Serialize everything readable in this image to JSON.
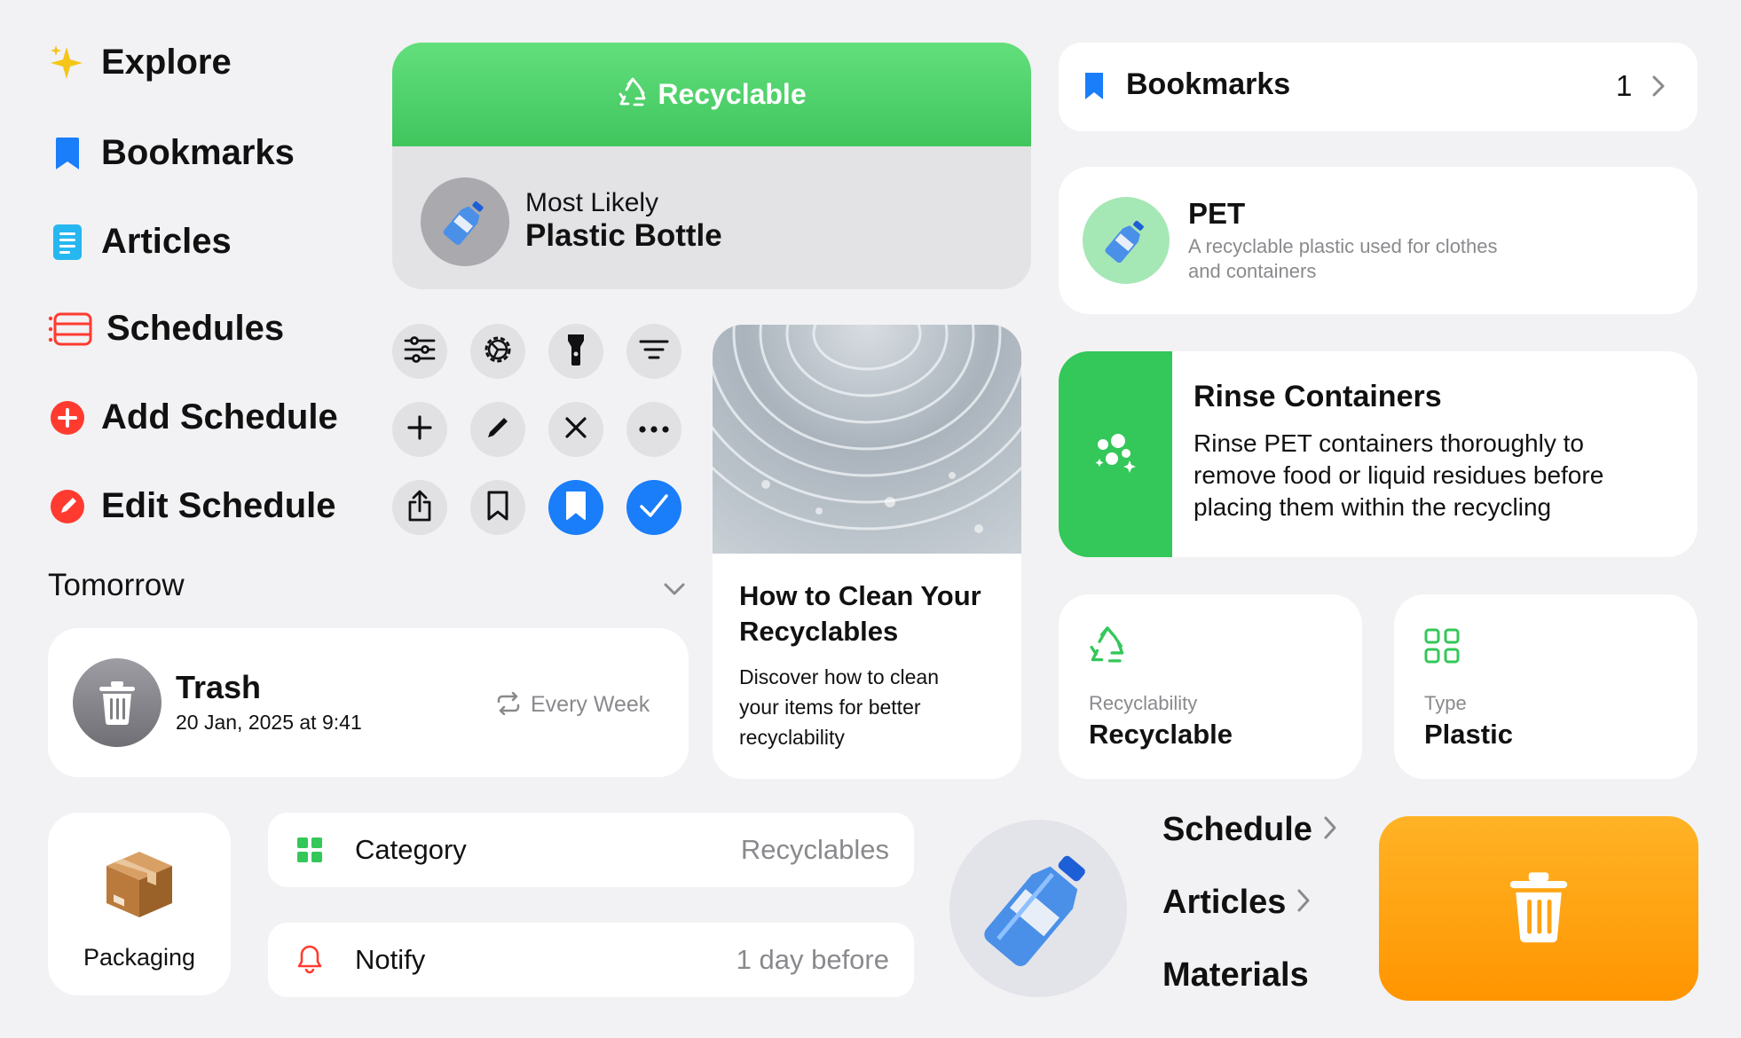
{
  "sidebar": {
    "items": [
      {
        "label": "Explore"
      },
      {
        "label": "Bookmarks"
      },
      {
        "label": "Articles"
      },
      {
        "label": "Schedules"
      },
      {
        "label": "Add Schedule"
      },
      {
        "label": "Edit Schedule"
      }
    ]
  },
  "scan_card": {
    "header": "Recyclable",
    "subtitle": "Most Likely",
    "title": "Plastic Bottle"
  },
  "schedule_section": {
    "header": "Tomorrow",
    "item_title": "Trash",
    "item_date": "20 Jan, 2025 at 9:41",
    "repeat": "Every Week"
  },
  "article_card": {
    "title": "How to Clean Your Recyclables",
    "body": "Discover how to clean your items for better recyclability"
  },
  "bookmarks_row": {
    "label": "Bookmarks",
    "count": "1"
  },
  "pet_card": {
    "title": "PET",
    "description": "A recyclable plastic used for clothes and containers"
  },
  "rinse_card": {
    "title": "Rinse Containers",
    "body": "Rinse PET containers thoroughly to remove food or liquid residues before placing them within the recycling"
  },
  "info_tiles": [
    {
      "label": "Recyclability",
      "value": "Recyclable"
    },
    {
      "label": "Type",
      "value": "Plastic"
    }
  ],
  "packaging_tile": {
    "label": "Packaging"
  },
  "settings_rows": [
    {
      "label": "Category",
      "value": "Recyclables"
    },
    {
      "label": "Notify",
      "value": "1 day before"
    }
  ],
  "nav_links": [
    {
      "label": "Schedule"
    },
    {
      "label": "Articles"
    },
    {
      "label": "Materials"
    }
  ],
  "colors": {
    "accent_green": "#34c759",
    "accent_blue": "#1a7dfa",
    "accent_orange": "#ff9500",
    "accent_red": "#ff3b30"
  }
}
